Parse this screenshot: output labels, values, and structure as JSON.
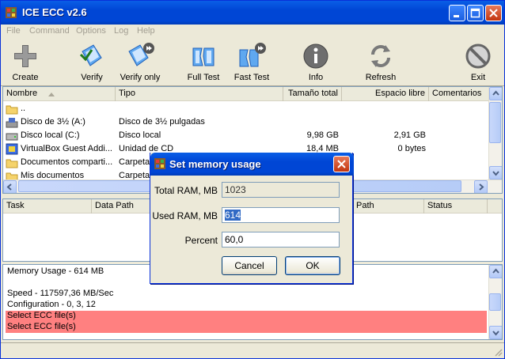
{
  "window": {
    "title": "ICE ECC v2.6"
  },
  "menu": [
    "File",
    "Command",
    "Options",
    "Log",
    "Help"
  ],
  "toolbar": [
    {
      "label": "Create",
      "icon": "plus-icon"
    },
    {
      "label": "Verify",
      "icon": "document-check-icon"
    },
    {
      "label": "Verify only",
      "icon": "document-check-play-icon"
    },
    {
      "label": "Full Test",
      "icon": "broken-document-icon"
    },
    {
      "label": "Fast Test",
      "icon": "broken-document-play-icon"
    },
    {
      "label": "Info",
      "icon": "info-icon"
    },
    {
      "label": "Refresh",
      "icon": "refresh-icon"
    },
    {
      "label": "Exit",
      "icon": "exit-icon"
    }
  ],
  "filelist": {
    "columns": [
      "Nombre",
      "Tipo",
      "Tamaño total",
      "Espacio libre",
      "Comentarios"
    ],
    "rows": [
      {
        "name": "..",
        "type": "",
        "total": "",
        "free": "",
        "icon": "folder-icon"
      },
      {
        "name": "Disco de 3½ (A:)",
        "type": "Disco de 3½ pulgadas",
        "total": "",
        "free": "",
        "icon": "floppy-drive-icon"
      },
      {
        "name": "Disco local (C:)",
        "type": "Disco local",
        "total": "9,98 GB",
        "free": "2,91 GB",
        "icon": "hard-drive-icon"
      },
      {
        "name": "VirtualBox Guest Addi...",
        "type": "Unidad de CD",
        "total": "18,4 MB",
        "free": "0 bytes",
        "icon": "cd-drive-icon"
      },
      {
        "name": "Documentos comparti...",
        "type": "Carpeta",
        "total": "",
        "free": "",
        "icon": "folder-icon"
      },
      {
        "name": "Mis documentos",
        "type": "Carpeta",
        "total": "",
        "free": "",
        "icon": "folder-icon"
      }
    ]
  },
  "tasklist": {
    "columns": [
      "Task",
      "Data Path",
      "Path",
      "Status"
    ]
  },
  "log": {
    "lines": [
      {
        "text": "Memory Usage - 614 MB",
        "error": false
      },
      {
        "text": "",
        "error": false
      },
      {
        "text": "Speed - 117597,36 MB/Sec",
        "error": false
      },
      {
        "text": "Configuration - 0, 3, 12",
        "error": false
      },
      {
        "text": "Select ECC file(s)",
        "error": true
      },
      {
        "text": "Select ECC file(s)",
        "error": true
      }
    ]
  },
  "dialog": {
    "title": "Set memory usage",
    "total_ram_label": "Total RAM, MB",
    "total_ram_value": "1023",
    "used_ram_label": "Used RAM, MB",
    "used_ram_value": "614",
    "percent_label": "Percent",
    "percent_value": "60,0",
    "cancel_label": "Cancel",
    "ok_label": "OK"
  }
}
